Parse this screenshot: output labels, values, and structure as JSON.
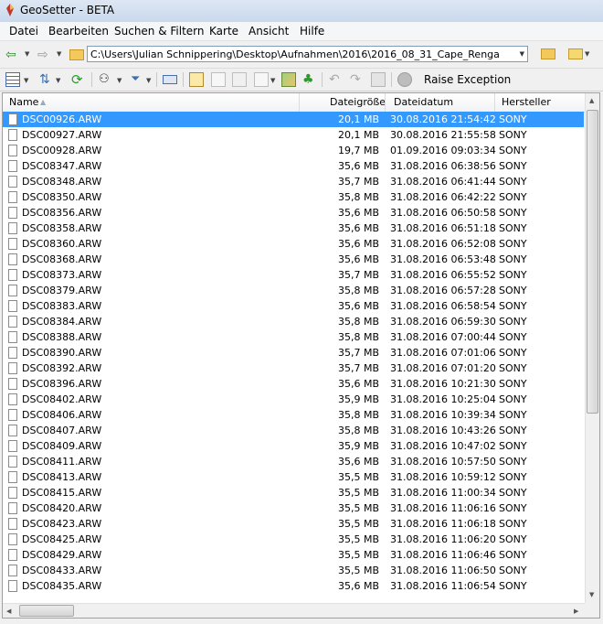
{
  "window": {
    "title": "GeoSetter - BETA"
  },
  "menu": [
    "Datei",
    "Bearbeiten",
    "Suchen & Filtern",
    "Karte",
    "Ansicht",
    "Hilfe"
  ],
  "address": {
    "path": "C:\\Users\\Julian Schnippering\\Desktop\\Aufnahmen\\2016\\2016_08_31_Cape_Renga"
  },
  "toolbar": {
    "raise_exception": "Raise Exception"
  },
  "columns": {
    "name": "Name",
    "size": "Dateigröße",
    "date": "Dateidatum",
    "maker": "Hersteller"
  },
  "files": [
    {
      "name": "DSC00926.ARW",
      "size": "20,1 MB",
      "date": "30.08.2016 21:54:42",
      "maker": "SONY"
    },
    {
      "name": "DSC00927.ARW",
      "size": "20,1 MB",
      "date": "30.08.2016 21:55:58",
      "maker": "SONY"
    },
    {
      "name": "DSC00928.ARW",
      "size": "19,7 MB",
      "date": "01.09.2016 09:03:34",
      "maker": "SONY"
    },
    {
      "name": "DSC08347.ARW",
      "size": "35,6 MB",
      "date": "31.08.2016 06:38:56",
      "maker": "SONY"
    },
    {
      "name": "DSC08348.ARW",
      "size": "35,7 MB",
      "date": "31.08.2016 06:41:44",
      "maker": "SONY"
    },
    {
      "name": "DSC08350.ARW",
      "size": "35,8 MB",
      "date": "31.08.2016 06:42:22",
      "maker": "SONY"
    },
    {
      "name": "DSC08356.ARW",
      "size": "35,6 MB",
      "date": "31.08.2016 06:50:58",
      "maker": "SONY"
    },
    {
      "name": "DSC08358.ARW",
      "size": "35,6 MB",
      "date": "31.08.2016 06:51:18",
      "maker": "SONY"
    },
    {
      "name": "DSC08360.ARW",
      "size": "35,6 MB",
      "date": "31.08.2016 06:52:08",
      "maker": "SONY"
    },
    {
      "name": "DSC08368.ARW",
      "size": "35,6 MB",
      "date": "31.08.2016 06:53:48",
      "maker": "SONY"
    },
    {
      "name": "DSC08373.ARW",
      "size": "35,7 MB",
      "date": "31.08.2016 06:55:52",
      "maker": "SONY"
    },
    {
      "name": "DSC08379.ARW",
      "size": "35,8 MB",
      "date": "31.08.2016 06:57:28",
      "maker": "SONY"
    },
    {
      "name": "DSC08383.ARW",
      "size": "35,6 MB",
      "date": "31.08.2016 06:58:54",
      "maker": "SONY"
    },
    {
      "name": "DSC08384.ARW",
      "size": "35,8 MB",
      "date": "31.08.2016 06:59:30",
      "maker": "SONY"
    },
    {
      "name": "DSC08388.ARW",
      "size": "35,8 MB",
      "date": "31.08.2016 07:00:44",
      "maker": "SONY"
    },
    {
      "name": "DSC08390.ARW",
      "size": "35,7 MB",
      "date": "31.08.2016 07:01:06",
      "maker": "SONY"
    },
    {
      "name": "DSC08392.ARW",
      "size": "35,7 MB",
      "date": "31.08.2016 07:01:20",
      "maker": "SONY"
    },
    {
      "name": "DSC08396.ARW",
      "size": "35,6 MB",
      "date": "31.08.2016 10:21:30",
      "maker": "SONY"
    },
    {
      "name": "DSC08402.ARW",
      "size": "35,9 MB",
      "date": "31.08.2016 10:25:04",
      "maker": "SONY"
    },
    {
      "name": "DSC08406.ARW",
      "size": "35,8 MB",
      "date": "31.08.2016 10:39:34",
      "maker": "SONY"
    },
    {
      "name": "DSC08407.ARW",
      "size": "35,8 MB",
      "date": "31.08.2016 10:43:26",
      "maker": "SONY"
    },
    {
      "name": "DSC08409.ARW",
      "size": "35,9 MB",
      "date": "31.08.2016 10:47:02",
      "maker": "SONY"
    },
    {
      "name": "DSC08411.ARW",
      "size": "35,6 MB",
      "date": "31.08.2016 10:57:50",
      "maker": "SONY"
    },
    {
      "name": "DSC08413.ARW",
      "size": "35,5 MB",
      "date": "31.08.2016 10:59:12",
      "maker": "SONY"
    },
    {
      "name": "DSC08415.ARW",
      "size": "35,5 MB",
      "date": "31.08.2016 11:00:34",
      "maker": "SONY"
    },
    {
      "name": "DSC08420.ARW",
      "size": "35,5 MB",
      "date": "31.08.2016 11:06:16",
      "maker": "SONY"
    },
    {
      "name": "DSC08423.ARW",
      "size": "35,5 MB",
      "date": "31.08.2016 11:06:18",
      "maker": "SONY"
    },
    {
      "name": "DSC08425.ARW",
      "size": "35,5 MB",
      "date": "31.08.2016 11:06:20",
      "maker": "SONY"
    },
    {
      "name": "DSC08429.ARW",
      "size": "35,5 MB",
      "date": "31.08.2016 11:06:46",
      "maker": "SONY"
    },
    {
      "name": "DSC08433.ARW",
      "size": "35,5 MB",
      "date": "31.08.2016 11:06:50",
      "maker": "SONY"
    },
    {
      "name": "DSC08435.ARW",
      "size": "35,6 MB",
      "date": "31.08.2016 11:06:54",
      "maker": "SONY"
    }
  ],
  "selected_index": 0
}
